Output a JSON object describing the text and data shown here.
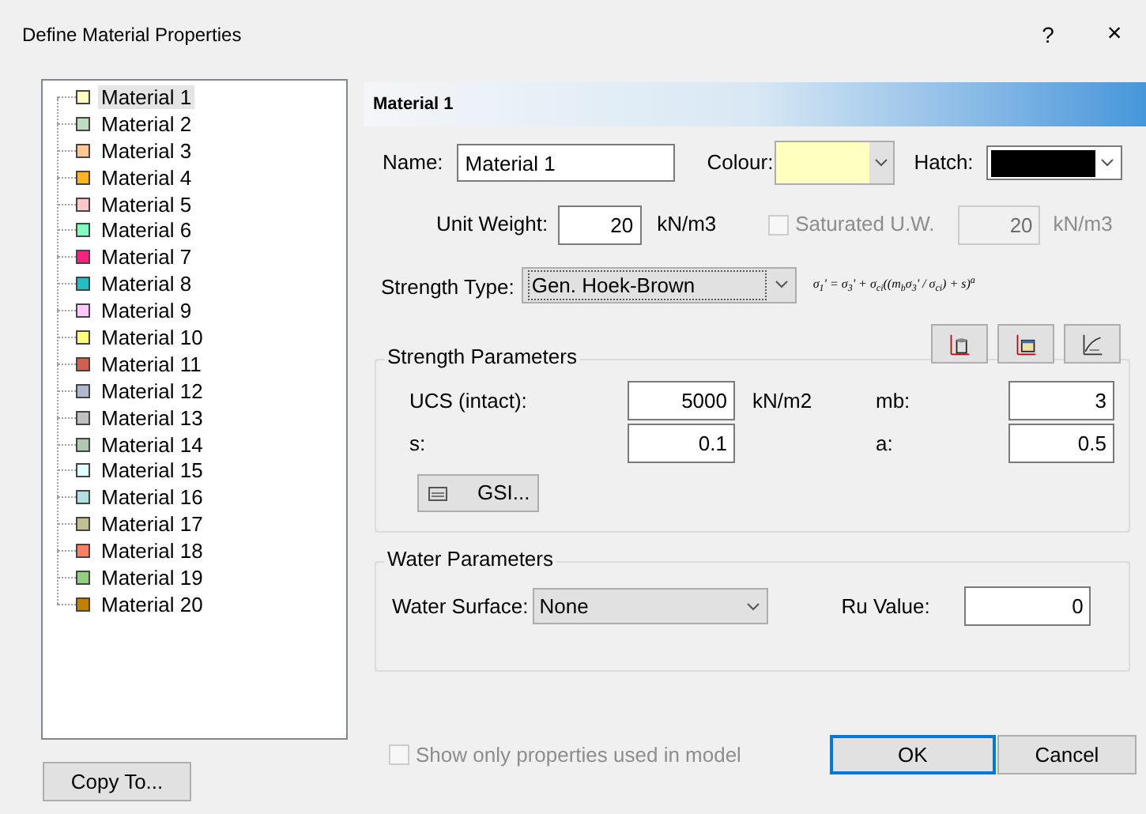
{
  "window": {
    "title": "Define Material Properties",
    "help": "?",
    "close": "×"
  },
  "materials": [
    {
      "label": "Material 1",
      "color": "#ffffc0",
      "selected": true
    },
    {
      "label": "Material 2",
      "color": "#c0dcc0",
      "selected": false
    },
    {
      "label": "Material 3",
      "color": "#ffc896",
      "selected": false
    },
    {
      "label": "Material 4",
      "color": "#ffb420",
      "selected": false
    },
    {
      "label": "Material 5",
      "color": "#ffc8c8",
      "selected": false
    },
    {
      "label": "Material 6",
      "color": "#80ffc0",
      "selected": false
    },
    {
      "label": "Material 7",
      "color": "#ff2080",
      "selected": false
    },
    {
      "label": "Material 8",
      "color": "#20c0c0",
      "selected": false
    },
    {
      "label": "Material 9",
      "color": "#ffc8ff",
      "selected": false
    },
    {
      "label": "Material 10",
      "color": "#ffff80",
      "selected": false
    },
    {
      "label": "Material 11",
      "color": "#d06050",
      "selected": false
    },
    {
      "label": "Material 12",
      "color": "#b0b8d0",
      "selected": false
    },
    {
      "label": "Material 13",
      "color": "#c0c0c0",
      "selected": false
    },
    {
      "label": "Material 14",
      "color": "#b0c8b0",
      "selected": false
    },
    {
      "label": "Material 15",
      "color": "#e0ffff",
      "selected": false
    },
    {
      "label": "Material 16",
      "color": "#b0e0e0",
      "selected": false
    },
    {
      "label": "Material 17",
      "color": "#c0c090",
      "selected": false
    },
    {
      "label": "Material 18",
      "color": "#ff8060",
      "selected": false
    },
    {
      "label": "Material 19",
      "color": "#90d080",
      "selected": false
    },
    {
      "label": "Material 20",
      "color": "#c08000",
      "selected": false
    }
  ],
  "header": "Material 1",
  "name": {
    "label": "Name:",
    "value": "Material 1"
  },
  "colour": {
    "label": "Colour:",
    "color": "#ffffc0"
  },
  "hatch": {
    "label": "Hatch:",
    "color": "#000000"
  },
  "unit_weight": {
    "label": "Unit Weight:",
    "value": "20",
    "unit": "kN/m3"
  },
  "saturated": {
    "label": "Saturated U.W.",
    "checked": false,
    "disabled": true,
    "value": "20",
    "unit": "kN/m3"
  },
  "strength_type": {
    "label": "Strength Type:",
    "value": "Gen. Hoek-Brown",
    "formula": "σ$_{1}$' = σ$_{3}$' + σ$_{ci}$((m$_{b}$σ$_{3}$' / σ$_{ci}$) + s)$^{a}$"
  },
  "strength_parameters": {
    "title": "Strength Parameters",
    "fields": [
      {
        "label": "UCS (intact):",
        "value": "5000",
        "unit": "kN/m2"
      },
      {
        "label": "mb:",
        "value": "3"
      },
      {
        "label": "s:",
        "value": "0.1"
      },
      {
        "label": "a:",
        "value": "0.5"
      }
    ],
    "gsi_button": "GSI..."
  },
  "water_parameters": {
    "title": "Water Parameters",
    "surface_label": "Water Surface:",
    "surface_value": "None",
    "ru_label": "Ru Value:",
    "ru_value": "0"
  },
  "copy_button": "Copy To...",
  "show_only": {
    "label": "Show only properties used in model",
    "checked": false,
    "disabled": true
  },
  "buttons": [
    {
      "label": "OK",
      "default": true
    },
    {
      "label": "Cancel",
      "default": false
    }
  ]
}
